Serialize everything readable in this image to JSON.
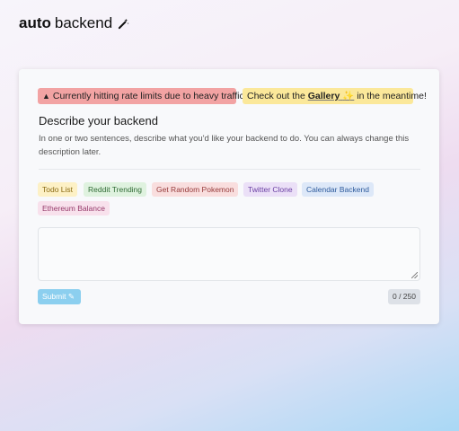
{
  "logo": {
    "bold": "auto",
    "regular": "backend",
    "icon": "magic-wand-icon"
  },
  "alerts": {
    "rate_limit": "Currently hitting rate limits due to heavy traffic.",
    "gallery_prefix": "Check out the",
    "gallery_link": "Gallery",
    "gallery_suffix": "in the meantime!"
  },
  "form": {
    "heading": "Describe your backend",
    "description": "In one or two sentences, describe what you'd like your backend to do. You can always change this description later.",
    "textarea_value": "",
    "submit_label": "Submit",
    "counter": "0 / 250"
  },
  "examples": [
    {
      "label": "Todo List",
      "bg": "#fdf1c6",
      "fg": "#8a6a12"
    },
    {
      "label": "Reddit Trending",
      "bg": "#dff2df",
      "fg": "#2f6b34"
    },
    {
      "label": "Get Random Pokemon",
      "bg": "#f9dede",
      "fg": "#963a3a"
    },
    {
      "label": "Twitter Clone",
      "bg": "#ebe0f7",
      "fg": "#6a3fa3"
    },
    {
      "label": "Calendar Backend",
      "bg": "#dde8f8",
      "fg": "#2d5a9c"
    },
    {
      "label": "Ethereum Balance",
      "bg": "#f8e1ec",
      "fg": "#963a6a"
    }
  ]
}
